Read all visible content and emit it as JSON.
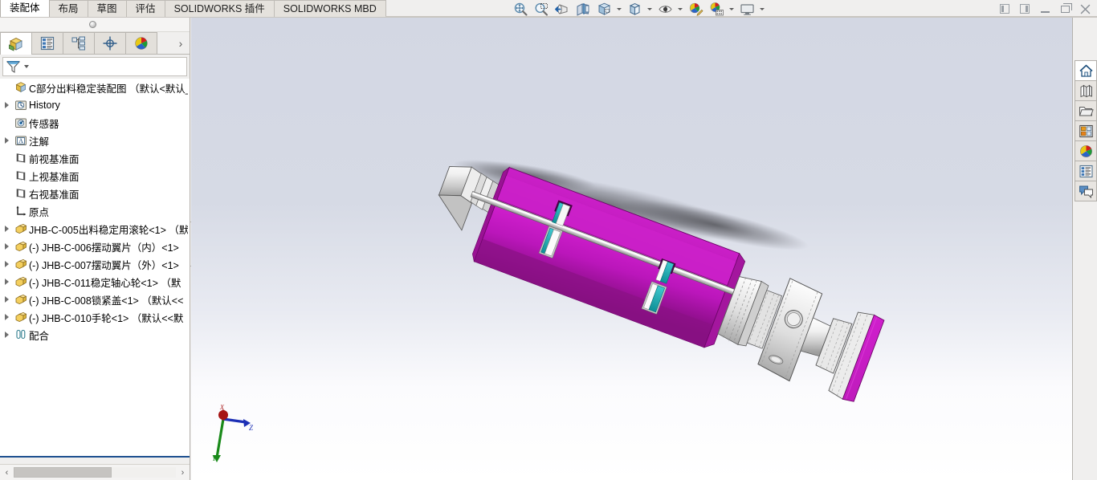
{
  "ribbon": {
    "tabs": [
      {
        "label": "装配体",
        "active": true
      },
      {
        "label": "布局",
        "active": false
      },
      {
        "label": "草图",
        "active": false
      },
      {
        "label": "评估",
        "active": false
      },
      {
        "label": "SOLIDWORKS 插件",
        "active": false
      },
      {
        "label": "SOLIDWORKS MBD",
        "active": false
      }
    ]
  },
  "toolbar": {
    "buttons": [
      {
        "name": "zoom-to-fit-icon",
        "title": "整屏显示全图"
      },
      {
        "name": "zoom-to-area-icon",
        "title": "局部放大"
      },
      {
        "name": "previous-view-icon",
        "title": "上一视图"
      },
      {
        "name": "section-view-icon",
        "title": "剖面视图"
      },
      {
        "name": "view-orientation-icon",
        "title": "视图定向",
        "has_caret": true
      },
      {
        "name": "display-style-icon",
        "title": "显示样式",
        "has_caret": true
      },
      {
        "name": "hide-show-items-icon",
        "title": "隐藏/显示项目",
        "has_caret": true
      },
      {
        "name": "edit-appearance-icon",
        "title": "编辑外观",
        "has_caret": false
      },
      {
        "name": "apply-scene-icon",
        "title": "应用布景",
        "has_caret": true
      },
      {
        "name": "view-settings-icon",
        "title": "视图设定",
        "has_caret": true
      }
    ]
  },
  "window_controls": {
    "restore_doc_left": "restore-left",
    "restore_doc_right": "restore-right",
    "minimize": "minimize",
    "maximize": "maximize",
    "close": "close"
  },
  "manager_panel": {
    "tabs": [
      {
        "name": "feature-manager-tab",
        "label": "FeatureManager 设计树",
        "active": true
      },
      {
        "name": "property-manager-tab",
        "label": "PropertyManager",
        "active": false
      },
      {
        "name": "configuration-manager-tab",
        "label": "ConfigurationManager",
        "active": false
      },
      {
        "name": "dimxpert-manager-tab",
        "label": "DimXpertManager",
        "active": false
      },
      {
        "name": "display-manager-tab",
        "label": "DisplayManager",
        "active": false
      }
    ],
    "more_tabs_label": "›",
    "filter_placeholder": "",
    "tree": [
      {
        "label": "C部分出料稳定装配图 （默认<默认_显示",
        "icon": "assembly-icon",
        "indent": 0,
        "arrow": false
      },
      {
        "label": "History",
        "icon": "history-folder-icon",
        "indent": 1,
        "arrow": true
      },
      {
        "label": "传感器",
        "icon": "sensors-folder-icon",
        "indent": 1,
        "arrow": false
      },
      {
        "label": "注解",
        "icon": "annotations-folder-icon",
        "indent": 1,
        "arrow": true
      },
      {
        "label": "前视基准面",
        "icon": "plane-icon",
        "indent": 1,
        "arrow": false
      },
      {
        "label": "上视基准面",
        "icon": "plane-icon",
        "indent": 1,
        "arrow": false
      },
      {
        "label": "右视基准面",
        "icon": "plane-icon",
        "indent": 1,
        "arrow": false
      },
      {
        "label": "原点",
        "icon": "origin-icon",
        "indent": 1,
        "arrow": false
      },
      {
        "label": "JHB-C-005出料稳定用滚轮<1> （默",
        "icon": "part-icon",
        "indent": 1,
        "arrow": true
      },
      {
        "label": "(-) JHB-C-006摆动翼片（内）<1>",
        "icon": "part-icon",
        "indent": 1,
        "arrow": true
      },
      {
        "label": "(-) JHB-C-007摆动翼片（外）<1>",
        "icon": "part-icon",
        "indent": 1,
        "arrow": true
      },
      {
        "label": "(-) JHB-C-011稳定轴心轮<1> （默",
        "icon": "part-icon",
        "indent": 1,
        "arrow": true
      },
      {
        "label": "(-) JHB-C-008锁紧盖<1> （默认<<",
        "icon": "part-icon",
        "indent": 1,
        "arrow": true
      },
      {
        "label": "(-) JHB-C-010手轮<1> （默认<<默",
        "icon": "part-icon",
        "indent": 1,
        "arrow": true
      },
      {
        "label": "配合",
        "icon": "mates-icon",
        "indent": 1,
        "arrow": true
      }
    ],
    "hscroll": {
      "left_arrow": "‹",
      "right_arrow": "›"
    }
  },
  "task_pane": {
    "tabs": [
      {
        "name": "solidworks-resources-tab",
        "label": "SOLIDWORKS 资源",
        "icon": "home-icon",
        "active": true
      },
      {
        "name": "design-library-tab",
        "label": "设计库",
        "icon": "library-icon",
        "active": false
      },
      {
        "name": "file-explorer-tab",
        "label": "文件探索器",
        "icon": "folder-icon",
        "active": false
      },
      {
        "name": "view-palette-tab",
        "label": "视图调色板",
        "icon": "view-palette-icon",
        "active": false
      },
      {
        "name": "appearances-scenes-tab",
        "label": "外观、布景和贴图",
        "icon": "appearances-icon",
        "active": false
      },
      {
        "name": "custom-properties-tab",
        "label": "自定义属性",
        "icon": "properties-icon",
        "active": false
      },
      {
        "name": "forum-tab",
        "label": "SOLIDWORKS 论坛",
        "icon": "forum-icon",
        "active": false
      }
    ]
  },
  "viewport": {
    "triad": {
      "x_label": "Z",
      "y_label": "Y",
      "z_label": "X"
    },
    "colors": {
      "magenta_body": "#c01fc0",
      "magenta_dark": "#8d1184",
      "teal_vane": "#1aa8ae",
      "metal_light": "#ffffff",
      "metal_mid": "#d2d2d2",
      "background_top": "#d3d7e3",
      "background_bottom": "#ffffff"
    }
  }
}
